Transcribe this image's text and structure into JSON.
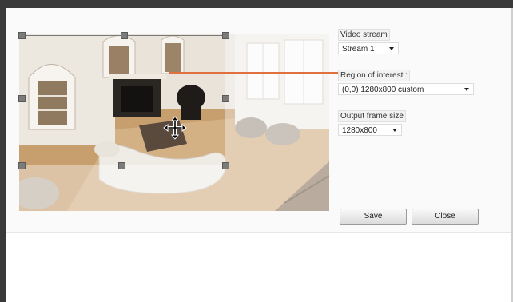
{
  "video_stream": {
    "label": "Video stream",
    "value": "Stream 1"
  },
  "region_of_interest": {
    "label": "Region of interest",
    "value": "(0,0) 1280x800 custom"
  },
  "output_frame_size": {
    "label": "Output frame size",
    "value": "1280x800"
  },
  "buttons": {
    "save": "Save",
    "close": "Close"
  },
  "icons": {
    "move": "move-icon",
    "dropdown": "chevron-down-icon"
  },
  "colors": {
    "callout_line": "#e07040",
    "handle": "#7b7b7b"
  }
}
